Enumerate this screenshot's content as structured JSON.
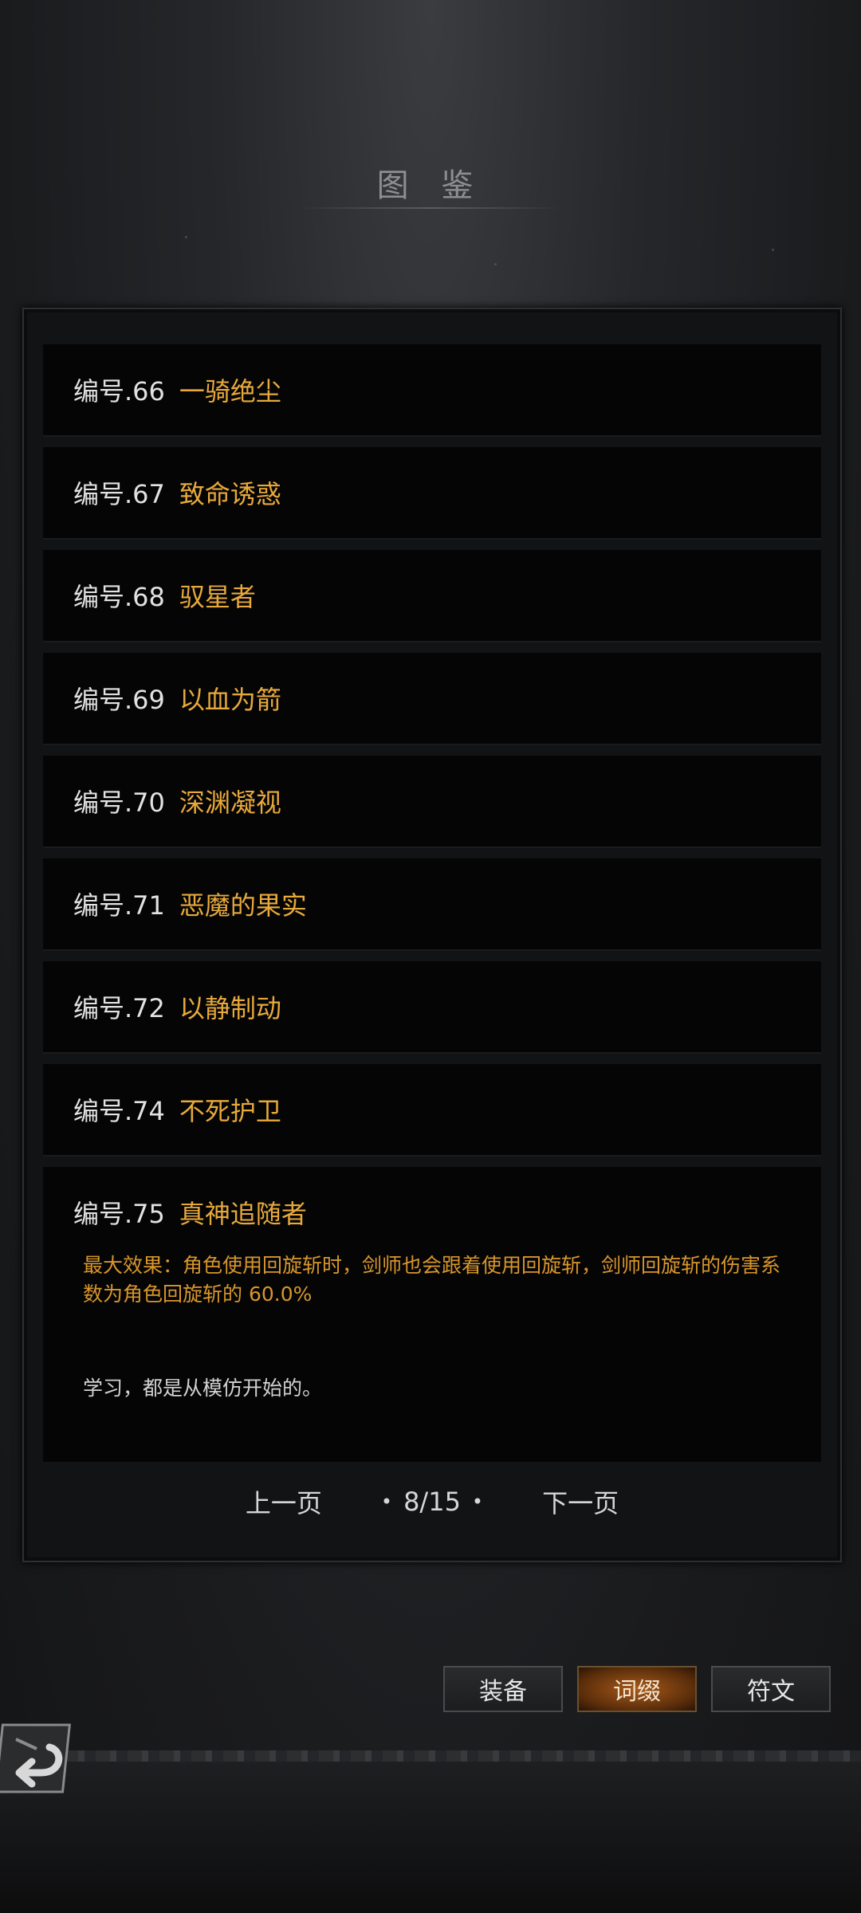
{
  "page": {
    "title": "图 鉴"
  },
  "entries": [
    {
      "num": "编号.66",
      "name": "一骑绝尘"
    },
    {
      "num": "编号.67",
      "name": "致命诱惑"
    },
    {
      "num": "编号.68",
      "name": "驭星者"
    },
    {
      "num": "编号.69",
      "name": "以血为箭"
    },
    {
      "num": "编号.70",
      "name": "深渊凝视"
    },
    {
      "num": "编号.71",
      "name": "恶魔的果实"
    },
    {
      "num": "编号.72",
      "name": "以静制动"
    },
    {
      "num": "编号.74",
      "name": "不死护卫"
    }
  ],
  "expanded": {
    "num": "编号.75",
    "name": "真神追随者",
    "effect": "最大效果：角色使用回旋斩时，剑师也会跟着使用回旋斩，剑师回旋斩的伤害系数为角色回旋斩的 60.0%",
    "quote": "学习，都是从模仿开始的。"
  },
  "pager": {
    "prev": "上一页",
    "page": "8/15",
    "next": "下一页"
  },
  "tabs": {
    "equip": "装备",
    "affix": "词缀",
    "rune": "符文"
  },
  "icons": {
    "back": "back-arrow-icon"
  },
  "colors": {
    "accent": "#e8a93c",
    "active_tab": "#a85a1a"
  }
}
